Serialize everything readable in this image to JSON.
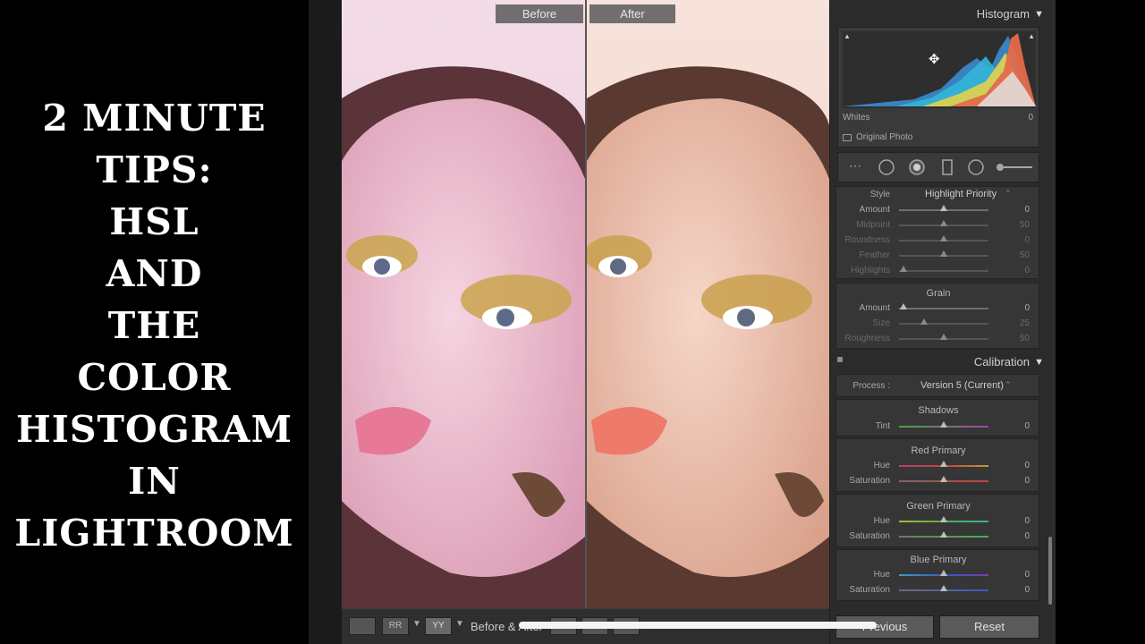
{
  "title_lines": [
    "2 MINUTE",
    "TIPS:",
    "HSL",
    "AND",
    "THE",
    "COLOR",
    "HISTOGRAM",
    "IN",
    "LIGHTROOM"
  ],
  "photo": {
    "before_label": "Before",
    "after_label": "After"
  },
  "toolbar": {
    "view_text": "Before & After",
    "flags": "RR",
    "view_mode": "YY"
  },
  "right_panel": {
    "histogram": {
      "title": "Histogram",
      "readout_label": "Whites",
      "readout_value": "0",
      "original_photo": "Original Photo"
    },
    "vignette": {
      "style_label": "Style",
      "style_value": "Highlight Priority",
      "sliders": [
        {
          "label": "Amount",
          "value": "0",
          "pos": 0.5,
          "dim": false
        },
        {
          "label": "Midpoint",
          "value": "50",
          "pos": 0.5,
          "dim": true
        },
        {
          "label": "Roundness",
          "value": "0",
          "pos": 0.5,
          "dim": true
        },
        {
          "label": "Feather",
          "value": "50",
          "pos": 0.5,
          "dim": true
        },
        {
          "label": "Highlights",
          "value": "0",
          "pos": 0.05,
          "dim": true
        }
      ]
    },
    "grain": {
      "title": "Grain",
      "sliders": [
        {
          "label": "Amount",
          "value": "0",
          "pos": 0.05,
          "dim": false
        },
        {
          "label": "Size",
          "value": "25",
          "pos": 0.28,
          "dim": true
        },
        {
          "label": "Roughness",
          "value": "50",
          "pos": 0.5,
          "dim": true
        }
      ]
    },
    "calibration": {
      "title": "Calibration",
      "process_label": "Process :",
      "process_value": "Version 5 (Current)",
      "shadows": {
        "title": "Shadows",
        "tint_label": "Tint",
        "tint_value": "0"
      },
      "red": {
        "title": "Red Primary",
        "hue_label": "Hue",
        "hue_value": "0",
        "sat_label": "Saturation",
        "sat_value": "0"
      },
      "green": {
        "title": "Green Primary",
        "hue_label": "Hue",
        "hue_value": "0",
        "sat_label": "Saturation",
        "sat_value": "0"
      },
      "blue": {
        "title": "Blue Primary",
        "hue_label": "Hue",
        "hue_value": "0",
        "sat_label": "Saturation",
        "sat_value": "0"
      }
    },
    "buttons": {
      "previous": "Previous",
      "reset": "Reset"
    }
  }
}
